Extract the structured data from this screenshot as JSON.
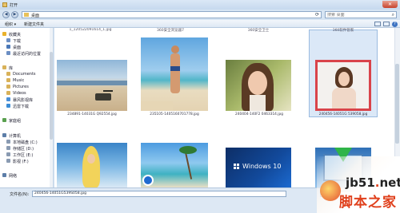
{
  "window": {
    "title": "打开",
    "close_glyph": "✕"
  },
  "address": {
    "path": "桌面",
    "back_glyph": "◀",
    "forward_glyph": "▶",
    "refresh_glyph": "⟳"
  },
  "search": {
    "placeholder": "搜索 桌面",
    "icon": "search-icon"
  },
  "toolbar": {
    "organize": "组织 ▾",
    "new_folder": "新建文件夹",
    "help_glyph": "?"
  },
  "sidebar": {
    "items": [
      {
        "label": "收藏夹",
        "icon": "star-icon",
        "color": "#e9b22c"
      },
      {
        "label": "下载",
        "icon": "download-folder-icon",
        "color": "#6c8fc4"
      },
      {
        "label": "桌面",
        "icon": "desktop-icon",
        "color": "#4a78b8"
      },
      {
        "label": "最近访问的位置",
        "icon": "recent-places-icon",
        "color": "#6c8fc4"
      },
      {
        "label": "库",
        "icon": "library-icon",
        "color": "#d9b25a"
      },
      {
        "label": "Documents",
        "icon": "documents-icon",
        "color": "#d9b25a"
      },
      {
        "label": "Music",
        "icon": "music-icon",
        "color": "#d9b25a"
      },
      {
        "label": "Pictures",
        "icon": "pictures-icon",
        "color": "#d9b25a"
      },
      {
        "label": "Videos",
        "icon": "videos-icon",
        "color": "#d9b25a"
      },
      {
        "label": "暴风影视库",
        "icon": "video-library-icon",
        "color": "#4a90d9"
      },
      {
        "label": "迅雷下载",
        "icon": "thunder-download-icon",
        "color": "#3c8dd6"
      },
      {
        "label": "家庭组",
        "icon": "homegroup-icon",
        "color": "#5aa04f"
      },
      {
        "label": "计算机",
        "icon": "computer-icon",
        "color": "#5d7ea8"
      },
      {
        "label": "本地磁盘 (C:)",
        "icon": "drive-c-icon",
        "color": "#8a9bb2"
      },
      {
        "label": "存储区 (D:)",
        "icon": "drive-d-icon",
        "color": "#8a9bb2"
      },
      {
        "label": "工作区 (E:)",
        "icon": "drive-e-icon",
        "color": "#8a9bb2"
      },
      {
        "label": "影视 (F:)",
        "icon": "drive-f-icon",
        "color": "#8a9bb2"
      },
      {
        "label": "网络",
        "icon": "network-icon",
        "color": "#5d7ea8"
      }
    ]
  },
  "top_row_labels": [
    "1_120522091614_1.jpg",
    "360安全浏览器7",
    "360安全卫士",
    "360软件管家"
  ],
  "files": [
    {
      "caption": "234891-14031G Q92554.jpg"
    },
    {
      "caption": "235105-1405160701778.jpg"
    },
    {
      "caption": "240404-140F2 0463314.jpg"
    },
    {
      "caption": "240456-14051G 539058.jpg"
    }
  ],
  "bottom_row": {
    "windows10_text": "Windows 10"
  },
  "filename": {
    "label": "文件名(N):",
    "value": "240456-14051G539S058.jpg"
  },
  "watermark": {
    "site_a": "jb51",
    "dot": ".",
    "site_b": "net",
    "tagline": "脚本之家"
  }
}
